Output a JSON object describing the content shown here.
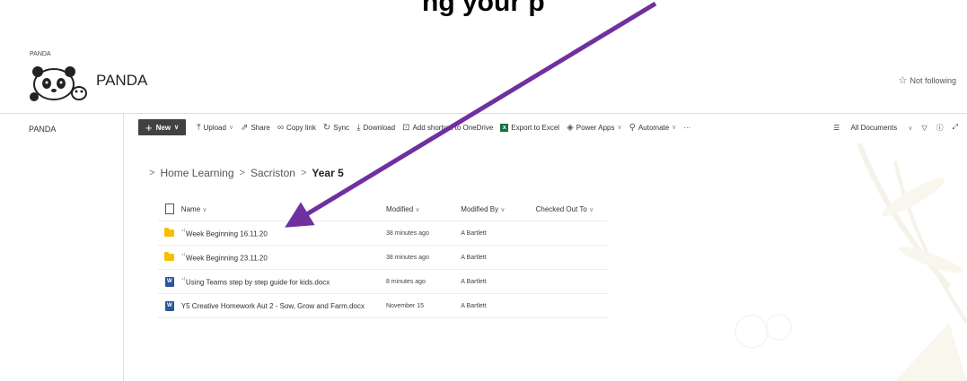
{
  "caption": "ng your p",
  "site": {
    "small_label": "PANDA",
    "title": "PANDA",
    "follow_label": "Not following"
  },
  "leftnav": {
    "items": [
      {
        "label": "PANDA"
      }
    ]
  },
  "commandbar": {
    "new_label": "New",
    "items": [
      {
        "label": "Upload",
        "icon": "upload-icon"
      },
      {
        "label": "Share",
        "icon": "share-icon"
      },
      {
        "label": "Copy link",
        "icon": "link-icon"
      },
      {
        "label": "Sync",
        "icon": "sync-icon"
      },
      {
        "label": "Download",
        "icon": "download-icon"
      },
      {
        "label": "Add shortcut to OneDrive",
        "icon": "shortcut-icon"
      },
      {
        "label": "Export to Excel",
        "icon": "excel-icon"
      },
      {
        "label": "Power Apps",
        "icon": "powerapps-icon"
      },
      {
        "label": "Automate",
        "icon": "automate-icon"
      }
    ],
    "view_label": "All Documents"
  },
  "breadcrumb": {
    "items": [
      "Home Learning",
      "Sacriston"
    ],
    "current": "Year 5"
  },
  "table": {
    "headers": {
      "name": "Name",
      "modified": "Modified",
      "modified_by": "Modified By",
      "checked_out": "Checked Out To"
    },
    "rows": [
      {
        "type": "folder",
        "name": "Week Beginning 16.11.20",
        "modified": "38 minutes ago",
        "modified_by": "A Bartlett",
        "new": true
      },
      {
        "type": "folder",
        "name": "Week Beginning 23.11.20",
        "modified": "38 minutes ago",
        "modified_by": "A Bartlett",
        "new": true
      },
      {
        "type": "word",
        "name": "Using Teams step by step guide for kids.docx",
        "modified": "8 minutes ago",
        "modified_by": "A Bartlett",
        "new": true
      },
      {
        "type": "word",
        "name": "Y5 Creative Homework Aut 2 - Sow, Grow and Farm.docx",
        "modified": "November 15",
        "modified_by": "A Bartlett",
        "new": false
      }
    ]
  },
  "colors": {
    "arrow": "#7030a0",
    "folder": "#f4c000",
    "word": "#2b579a",
    "new_button": "#414141"
  }
}
